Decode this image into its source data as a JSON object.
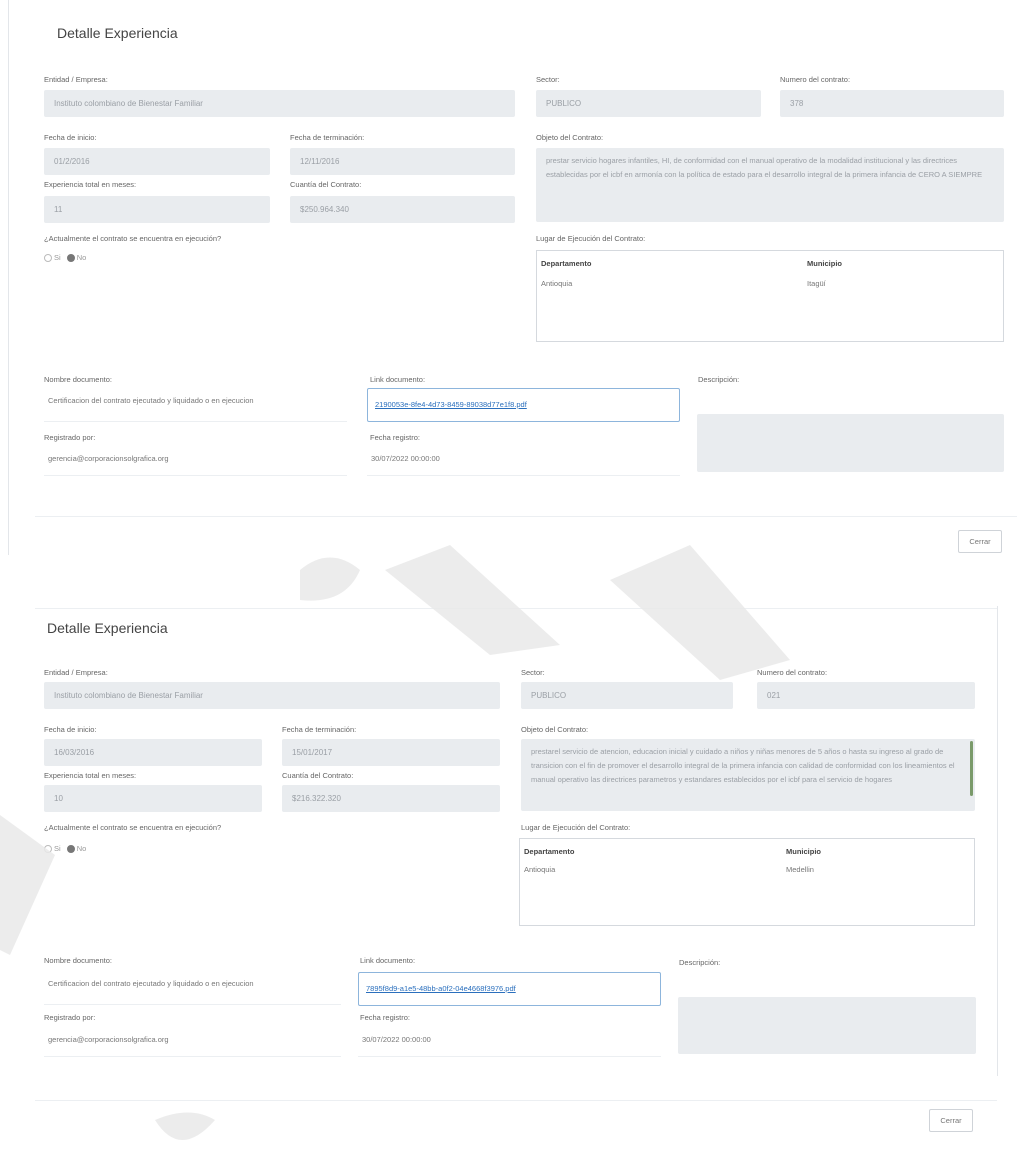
{
  "labels": {
    "entidad": "Entidad / Empresa:",
    "sector": "Sector:",
    "numero_contrato": "Numero del contrato:",
    "fecha_inicio": "Fecha de inicio:",
    "fecha_terminacion": "Fecha de terminación:",
    "objeto": "Objeto del Contrato:",
    "experiencia": "Experiencia total en meses:",
    "cuantia": "Cuantía del Contrato:",
    "actualmente": "¿Actualmente el contrato se encuentra en ejecución?",
    "radio_si": "Si",
    "radio_no": "No",
    "lugar": "Lugar de Ejecución del Contrato:",
    "departamento_col": "Departamento",
    "municipio_col": "Municipio",
    "nombre_documento": "Nombre documento:",
    "link_documento": "Link documento:",
    "descripcion": "Descripción:",
    "registrado_por": "Registrado por:",
    "fecha_registro": "Fecha registro:",
    "cerrar": "Cerrar"
  },
  "panel1": {
    "title": "Detalle Experiencia",
    "entidad": "Instituto colombiano de Bienestar Familiar",
    "sector": "PUBLICO",
    "numero_contrato": "378",
    "fecha_inicio": "01/2/2016",
    "fecha_terminacion": "12/11/2016",
    "objeto": "prestar servicio hogares infantiles, HI, de conformidad con el manual operativo de la modalidad institucional y las directrices establecidas por el icbf en armonía con la política de estado para el desarrollo integral de la primera infancia de CERO A SIEMPRE",
    "experiencia": "11",
    "cuantia": "$250.964.340",
    "departamento": "Antioquia",
    "municipio": "Itagüí",
    "nombre_documento": "Certificacion del contrato ejecutado y liquidado o en ejecucion",
    "link_documento": "2190053e-8fe4-4d73-8459-89038d77e1f8.pdf",
    "registrado_por": "gerencia@corporacionsolgrafica.org",
    "fecha_registro": "30/07/2022 00:00:00"
  },
  "panel2": {
    "title": "Detalle Experiencia",
    "entidad": "Instituto colombiano de Bienestar Familiar",
    "sector": "PUBLICO",
    "numero_contrato": "021",
    "fecha_inicio": "16/03/2016",
    "fecha_terminacion": "15/01/2017",
    "objeto": "prestarel servicio de atencion, educacion inicial y cuidado a niños y niñas menores de 5 años o hasta su ingreso al grado de transicion con el fin de promover el desarrollo integral de la primera infancia con calidad de conformidad con los lineamientos el manual operativo las directrices parametros y estandares establecidos por el icbf para el servicio de hogares",
    "experiencia": "10",
    "cuantia": "$216.322.320",
    "departamento": "Antioquia",
    "municipio": "Medellin",
    "nombre_documento": "Certificacion del contrato ejecutado y liquidado o en ejecucion",
    "link_documento": "7895f8d9-a1e5-48bb-a0f2-04e4668f3976.pdf",
    "registrado_por": "gerencia@corporacionsolgrafica.org",
    "fecha_registro": "30/07/2022 00:00:00"
  }
}
